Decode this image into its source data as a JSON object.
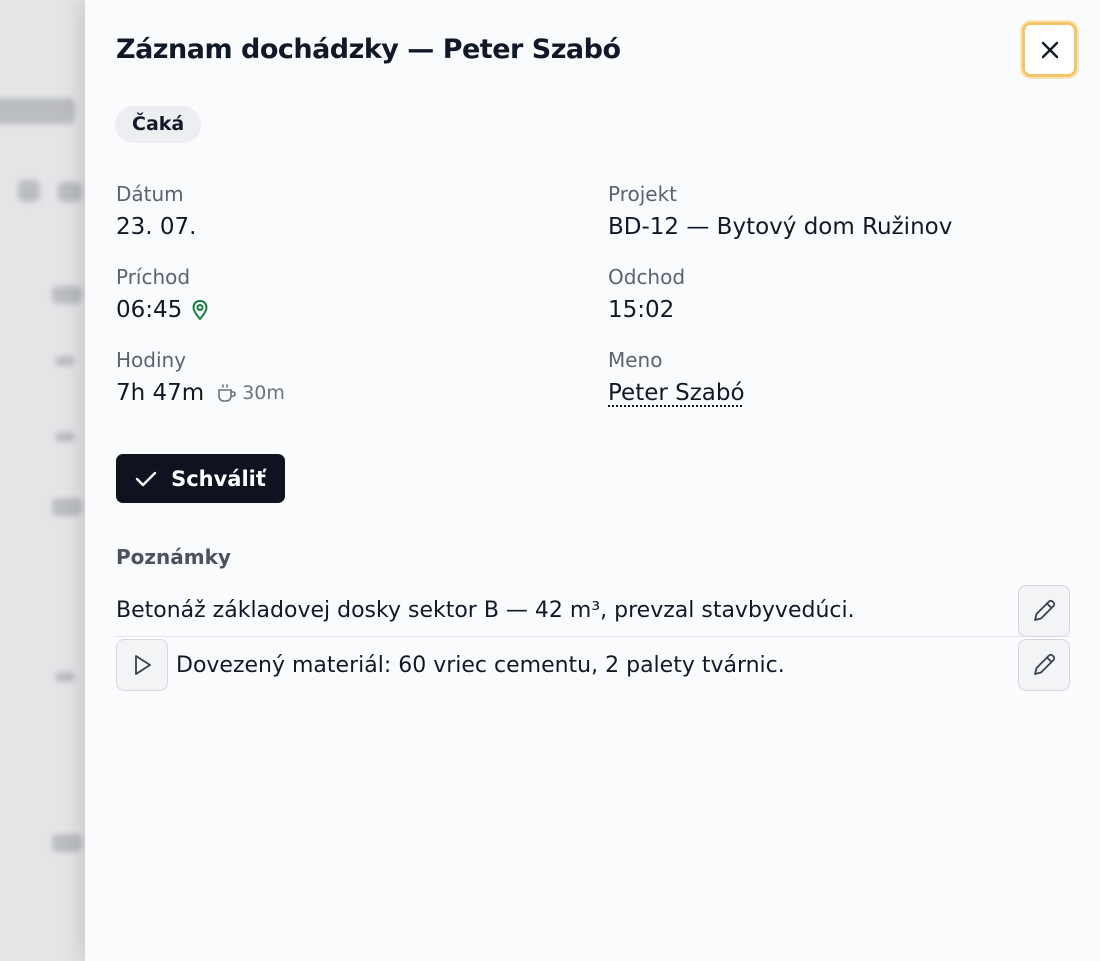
{
  "dialog": {
    "title": "Záznam dochádzky — Peter Szabó",
    "status_badge": "Čaká",
    "close_icon": "close-icon"
  },
  "fields": {
    "date": {
      "label": "Dátum",
      "value": "23. 07."
    },
    "project": {
      "label": "Projekt",
      "value": "BD-12 — Bytový dom Ružinov"
    },
    "arrival": {
      "label": "Príchod",
      "value": "06:45",
      "icon": "location-pin-icon",
      "icon_color": "#15803d"
    },
    "departure": {
      "label": "Odchod",
      "value": "15:02"
    },
    "hours": {
      "label": "Hodiny",
      "value": "7h 47m",
      "break_icon": "coffee-cup-icon",
      "break_value": "30m"
    },
    "name": {
      "label": "Meno",
      "value": "Peter Szabó"
    }
  },
  "actions": {
    "approve_label": "Schváliť",
    "approve_icon": "check-icon"
  },
  "notes": {
    "title": "Poznámky",
    "items": [
      {
        "text": "Betonáž základovej dosky sektor B — 42 m³, prevzal stavbyvedúci.",
        "has_audio": false
      },
      {
        "text": "Dovezený materiál: 60 vriec cementu, 2 palety tvárnic.",
        "has_audio": true
      }
    ]
  },
  "colors": {
    "accent_dark": "#0f1320",
    "focus_ring": "#f6c46a",
    "pin_green": "#15803d"
  }
}
